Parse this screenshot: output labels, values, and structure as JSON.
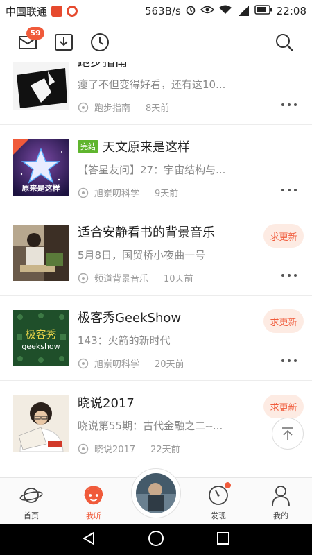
{
  "status_bar": {
    "carrier": "中国联通",
    "speed": "563B/s",
    "network": "4G",
    "time": "22:08"
  },
  "header": {
    "message_badge": "59",
    "icons": [
      "mail-icon",
      "download-icon",
      "history-clock-icon",
      "search-icon"
    ]
  },
  "items": [
    {
      "title": "跑步指南",
      "desc": "瘦了不但变得好看，还有这10...",
      "channel": "跑步指南",
      "time": "8天前",
      "finished": false,
      "request_update": false
    },
    {
      "title": "天文原来是这样",
      "tag": "完结",
      "desc": "【答星友问】27：宇宙结构与...",
      "channel": "旭岽叨科学",
      "time": "9天前",
      "finished": true,
      "request_update": false,
      "cover_text": "原来是这样"
    },
    {
      "title": "适合安静看书的背景音乐",
      "desc": "5月8日，国贸桥小夜曲一号",
      "channel": "频道背景音乐",
      "time": "10天前",
      "finished": false,
      "request_update": true,
      "request_label": "求更新"
    },
    {
      "title": "极客秀GeekShow",
      "desc": "143：火箭的新时代",
      "channel": "旭岽叨科学",
      "time": "20天前",
      "finished": false,
      "request_update": true,
      "request_label": "求更新",
      "cover_text_main": "极客秀",
      "cover_text_sub": "geekshow"
    },
    {
      "title": "晓说2017",
      "desc": "晓说第55期：古代金融之二--...",
      "channel": "晓说2017",
      "time": "22天前",
      "finished": false,
      "request_update": true,
      "request_label": "求更新"
    }
  ],
  "bottom_nav": {
    "tabs": [
      {
        "label": "首页",
        "icon": "planet-icon",
        "active": false
      },
      {
        "label": "我听",
        "icon": "headphone-face-icon",
        "active": true
      },
      {
        "label": "发现",
        "icon": "compass-icon",
        "active": false,
        "has_dot": true
      },
      {
        "label": "我的",
        "icon": "person-icon",
        "active": false
      }
    ]
  },
  "colors": {
    "accent": "#f05a3a",
    "done_tag": "#5fb52e",
    "request_bg": "#fdebe3"
  }
}
